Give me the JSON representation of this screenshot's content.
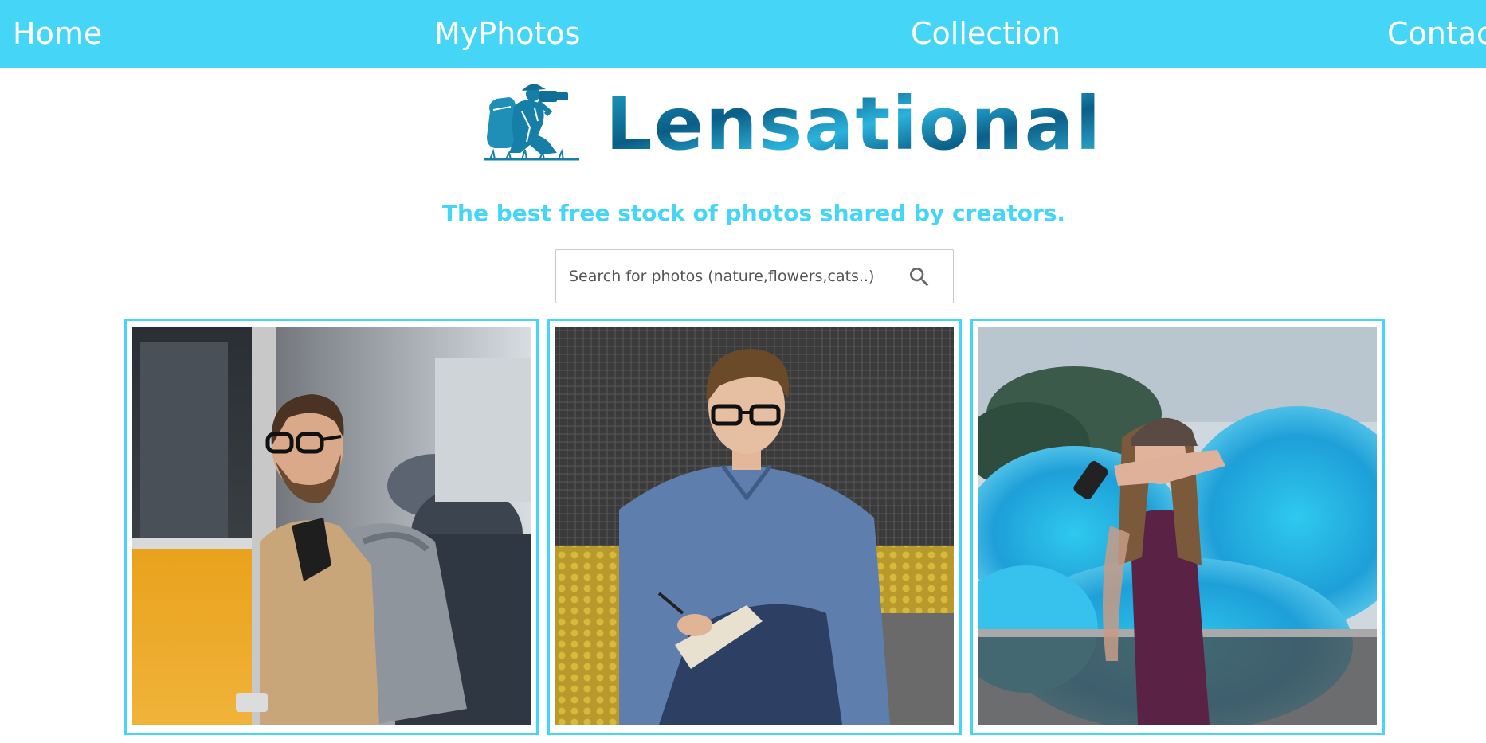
{
  "nav": {
    "items": [
      {
        "label": "Home"
      },
      {
        "label": "MyPhotos"
      },
      {
        "label": "Collection"
      },
      {
        "label": "Contact"
      }
    ]
  },
  "brand": {
    "logo_text": "Lensational",
    "logo_icon": "photographer-icon",
    "tagline": "The best free stock of photos shared by creators."
  },
  "search": {
    "placeholder": "Search for photos (nature,flowers,cats..)",
    "value": "",
    "icon": "search-icon"
  },
  "gallery": {
    "photos": [
      {
        "subject": "man-with-backpack-photo"
      },
      {
        "subject": "man-writing-notebook-photo"
      },
      {
        "subject": "woman-blue-smoke-photo"
      }
    ]
  },
  "colors": {
    "accent": "#45d5f6",
    "nav_text": "#ffffff",
    "logo_blue": "#0c6c96"
  }
}
